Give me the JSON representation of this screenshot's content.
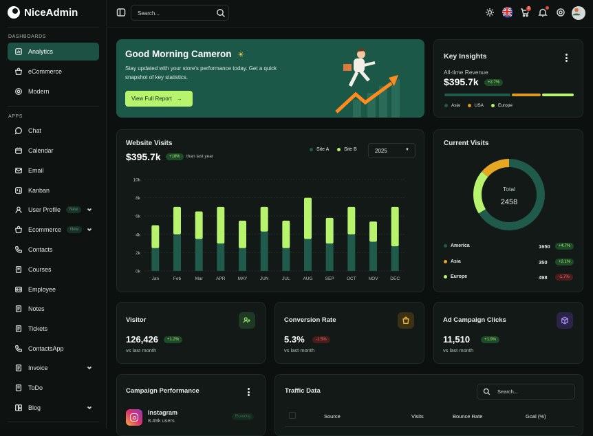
{
  "app": {
    "name": "NiceAdmin"
  },
  "sidebar": {
    "sections": [
      "DASHBOARDS",
      "APPS"
    ],
    "items": [
      {
        "label": "Analytics",
        "icon": "analytics-icon"
      },
      {
        "label": "eCommerce",
        "icon": "basket-icon"
      },
      {
        "label": "Modern",
        "icon": "target-icon"
      },
      {
        "label": "Chat",
        "icon": "chat-icon"
      },
      {
        "label": "Calendar",
        "icon": "calendar-icon"
      },
      {
        "label": "Email",
        "icon": "mail-icon"
      },
      {
        "label": "Kanban",
        "icon": "kanban-icon"
      },
      {
        "label": "User Profile",
        "icon": "user-icon",
        "badge": "New",
        "has_children": true
      },
      {
        "label": "Ecommerce",
        "icon": "cart-icon",
        "badge": "New",
        "has_children": true
      },
      {
        "label": "Contacts",
        "icon": "phone-icon"
      },
      {
        "label": "Courses",
        "icon": "book-icon"
      },
      {
        "label": "Employee",
        "icon": "id-card-icon"
      },
      {
        "label": "Notes",
        "icon": "notes-icon"
      },
      {
        "label": "Tickets",
        "icon": "ticket-icon"
      },
      {
        "label": "ContactsApp",
        "icon": "phone-icon"
      },
      {
        "label": "Invoice",
        "icon": "invoice-icon",
        "has_children": true
      },
      {
        "label": "ToDo",
        "icon": "todo-icon"
      },
      {
        "label": "Blog",
        "icon": "blog-icon",
        "has_children": true
      }
    ]
  },
  "topbar": {
    "search_placeholder": "Search...",
    "cart_count": "2"
  },
  "hero": {
    "title": "Good Morning Cameron",
    "subtitle_line1": "Stay updated with your store's performance today. Get a quick",
    "subtitle_line2": "snapshot of key statistics.",
    "button": "View Full Report"
  },
  "insights": {
    "title": "Key Insights",
    "subtitle": "All-time Revenue",
    "value": "$395.7k",
    "change": "+2.7%",
    "segments": [
      {
        "label": "Asia",
        "share": 0.52,
        "color": "#1f5a4a"
      },
      {
        "label": "USA",
        "share": 0.23,
        "color": "#d99a1d"
      },
      {
        "label": "Europe",
        "share": 0.25,
        "color": "#b7f36c"
      }
    ]
  },
  "visits": {
    "title": "Website Visits",
    "value": "$395.7k",
    "change": "+18%",
    "change_note": "than last year",
    "legend": [
      "Site A",
      "Site B"
    ],
    "year": "2025"
  },
  "chart_data": {
    "type": "bar",
    "stacked": true,
    "categories": [
      "Jan",
      "Feb",
      "Mar",
      "APR",
      "MAY",
      "JUN",
      "JUL",
      "AUG",
      "SEP",
      "OCT",
      "NOV",
      "DEC"
    ],
    "series": [
      {
        "name": "Site A",
        "color": "#1f5a4a",
        "values": [
          2.5,
          4.0,
          3.5,
          3.0,
          2.5,
          4.3,
          2.5,
          3.5,
          3.0,
          4.0,
          3.2,
          2.7
        ]
      },
      {
        "name": "Site B",
        "color": "#b7f36c",
        "values": [
          2.5,
          3.0,
          3.0,
          4.0,
          3.0,
          2.7,
          3.0,
          4.5,
          2.8,
          3.0,
          2.2,
          4.3
        ]
      }
    ],
    "yticks": [
      "0k",
      "2k",
      "4k",
      "6k",
      "8k",
      "10k"
    ],
    "ylim": [
      0,
      10
    ],
    "grid": true
  },
  "current_visits": {
    "title": "Current Visits",
    "center_label": "Total",
    "total": "2458",
    "rows": [
      {
        "label": "America",
        "value": "1650",
        "change": "+4.7%",
        "positive": true,
        "color": "#1f5a4a"
      },
      {
        "label": "Asia",
        "value": "350",
        "change": "+2.1%",
        "positive": true,
        "color": "#e7a723"
      },
      {
        "label": "Europe",
        "value": "498",
        "change": "-1.7%",
        "positive": false,
        "color": "#b7f36c"
      }
    ]
  },
  "stats": [
    {
      "title": "Visitor",
      "value": "126,426",
      "change": "+1.2%",
      "positive": true,
      "note": "vs last month",
      "icon": "user-plus-icon"
    },
    {
      "title": "Conversion Rate",
      "value": "5.3%",
      "change": "-1.5%",
      "positive": false,
      "note": "vs last month",
      "icon": "shopping-bag-icon"
    },
    {
      "title": "Ad Campaign Clicks",
      "value": "11,510",
      "change": "+1.9%",
      "positive": true,
      "note": "vs last month",
      "icon": "cube-icon"
    }
  ],
  "campaign": {
    "title": "Campaign Performance",
    "item_name": "Instagram",
    "item_users": "8.49k users",
    "item_status": "Running"
  },
  "traffic": {
    "title": "Traffic Data",
    "search_placeholder": "Search...",
    "columns": [
      "Source",
      "Visits",
      "Bounce Rate",
      "Goal (%)"
    ]
  }
}
